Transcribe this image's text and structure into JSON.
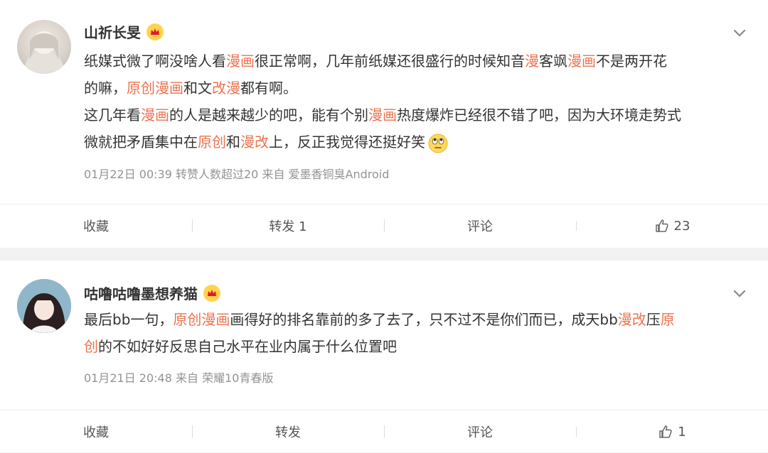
{
  "posts": [
    {
      "username": "山祈长旻",
      "content": {
        "line1_part1": "纸媒式微了啊没啥人看",
        "line1_hl1": "漫画",
        "line1_part2": "很正常啊，几年前纸媒还很盛行的时候知音",
        "line1_hl2": "漫",
        "line1_part3": "客飒",
        "line1_hl3": "漫画",
        "line1_part4": "不是两开花",
        "line2_part1": "的嘛，",
        "line2_hl1": "原创漫画",
        "line2_part2": "和文",
        "line2_hl2": "改漫",
        "line2_part3": "都有啊。",
        "line3_part1": "这几年看",
        "line3_hl1": "漫画",
        "line3_part2": "的人是越来越少的吧，能有个别",
        "line3_hl2": "漫画",
        "line3_part3": "热度爆炸已经很不错了吧，因为大环境走势式",
        "line4_part1": "微就把矛盾集中在",
        "line4_hl1": "原创",
        "line4_part2": "和",
        "line4_hl2": "漫改",
        "line4_part3": "上，反正我觉得还挺好笑"
      },
      "meta": "01月22日 00:39 转赞人数超过20  来自 爱墨香铜臭Android",
      "actions": {
        "collect": "收藏",
        "repost": "转发 1",
        "comment": "评论",
        "like": "23"
      }
    },
    {
      "username": "咕噜咕噜墨想养猫",
      "content": {
        "line1_part1": "最后bb一句，",
        "line1_hl1": "原创漫画",
        "line1_part2": "画得好的排名靠前的多了去了，只不过不是你们而已，成天bb",
        "line1_hl2": "漫改",
        "line1_part3": "压",
        "line1_hl3": "原",
        "line2_hl1": "创",
        "line2_part1": "的不如好好反思自己水平在业内属于什么位置吧"
      },
      "meta": "01月21日 20:48  来自 荣耀10青春版",
      "actions": {
        "collect": "收藏",
        "repost": "转发",
        "comment": "评论",
        "like": "1"
      }
    }
  ],
  "colors": {
    "highlight": "#eb7350",
    "text": "#333333",
    "meta": "#939393"
  },
  "icons": [
    "crown-badge-icon",
    "chevron-down-icon",
    "thumbs-up-icon",
    "rolling-eyes-emoji-icon"
  ]
}
